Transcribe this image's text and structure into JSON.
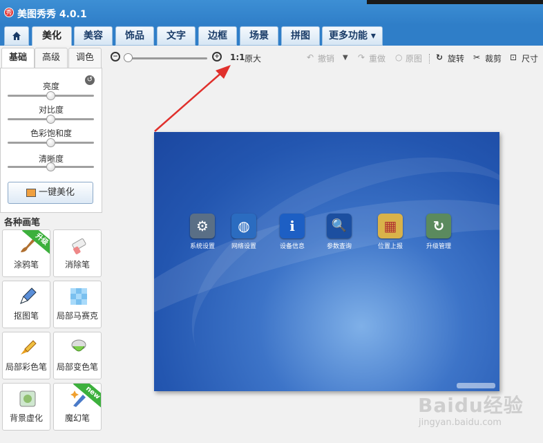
{
  "app": {
    "title": "美图秀秀 4.0.1",
    "logo_text": "秀"
  },
  "tabs": [
    {
      "label": "美化",
      "active": true
    },
    {
      "label": "美容"
    },
    {
      "label": "饰品"
    },
    {
      "label": "文字"
    },
    {
      "label": "边框"
    },
    {
      "label": "场景"
    },
    {
      "label": "拼图"
    },
    {
      "label": "更多功能 ▾"
    }
  ],
  "left": {
    "subtabs": [
      "基础",
      "高级",
      "调色"
    ],
    "sliders": [
      {
        "label": "亮度",
        "value": 0.5
      },
      {
        "label": "对比度",
        "value": 0.5
      },
      {
        "label": "色彩饱和度",
        "value": 0.5
      },
      {
        "label": "清晰度",
        "value": 0.5
      }
    ],
    "onekey_label": "一键美化",
    "brushes_title": "各种画笔",
    "brushes": [
      {
        "label": "涂鸦笔",
        "badge": "升级"
      },
      {
        "label": "消除笔"
      },
      {
        "label": "抠图笔"
      },
      {
        "label": "局部马赛克"
      },
      {
        "label": "局部彩色笔"
      },
      {
        "label": "局部变色笔"
      },
      {
        "label": "背景虚化"
      },
      {
        "label": "魔幻笔",
        "badge": "new"
      }
    ]
  },
  "toolbar": {
    "zoom_level": 0.0,
    "actual_size_label": "1:1",
    "actual_size_text": "原大",
    "undo": "撤销",
    "redo": "重做",
    "original": "原图",
    "rotate": "旋转",
    "crop": "裁剪",
    "size": "尺寸"
  },
  "canvas": {
    "apps": [
      {
        "label": "系统设置",
        "icon": "gear-icon",
        "color": "#5a6f86"
      },
      {
        "label": "网络设置",
        "icon": "globe-icon",
        "color": "#2b6cc0"
      },
      {
        "label": "设备信息",
        "icon": "info-icon",
        "color": "#1d5fc4"
      },
      {
        "label": "参数查询",
        "icon": "search-icon",
        "color": "#1c4fa0"
      },
      {
        "label": "位置上报",
        "icon": "map-icon",
        "color": "#d9b24a"
      },
      {
        "label": "升级管理",
        "icon": "update-icon",
        "color": "#5b8a5e"
      }
    ],
    "glyphs": [
      "⚙",
      "◍",
      "i",
      "🔍",
      "▦",
      "↻"
    ]
  },
  "watermark": {
    "brand": "Baidu经验",
    "url": "jingyan.baidu.com"
  },
  "colors": {
    "accent": "#2f7ec8",
    "arrow": "#e0302c"
  }
}
